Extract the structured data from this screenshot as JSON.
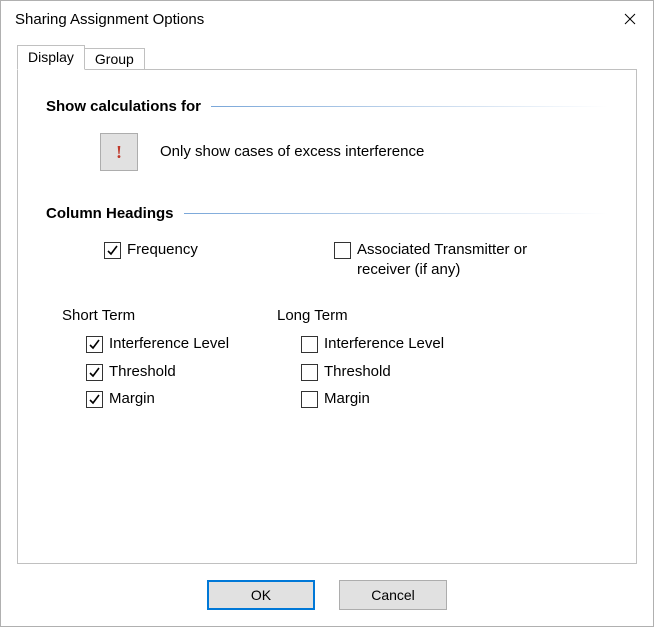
{
  "window": {
    "title": "Sharing Assignment Options"
  },
  "tabs": {
    "display": "Display",
    "group": "Group",
    "active": "Display"
  },
  "section1": {
    "heading": "Show calculations for",
    "toggle_glyph": "!",
    "toggle_label": "Only show cases of excess interference"
  },
  "section2": {
    "heading": "Column Headings",
    "frequency": "Frequency",
    "associated": "Associated Transmitter or receiver (if any)",
    "short_term": "Short Term",
    "long_term": "Long Term",
    "interference_level": "Interference Level",
    "threshold": "Threshold",
    "margin": "Margin"
  },
  "checked": {
    "frequency": true,
    "associated": false,
    "st_interference": true,
    "st_threshold": true,
    "st_margin": true,
    "lt_interference": false,
    "lt_threshold": false,
    "lt_margin": false
  },
  "footer": {
    "ok": "OK",
    "cancel": "Cancel"
  }
}
